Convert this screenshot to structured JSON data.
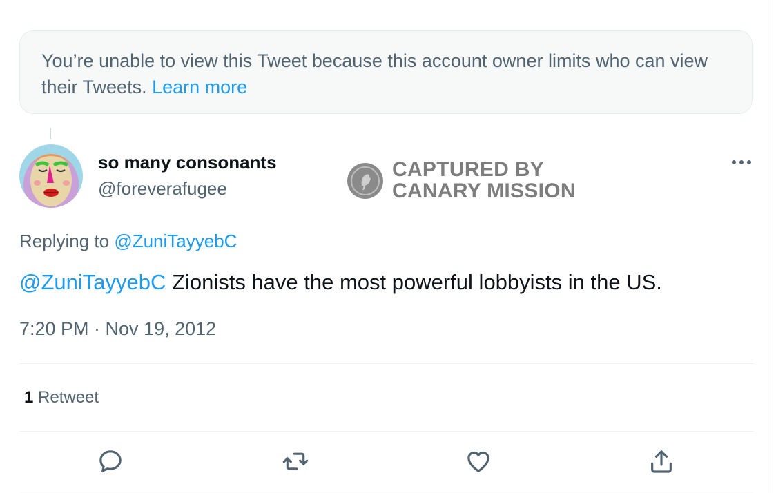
{
  "notice": {
    "text": "You’re unable to view this Tweet because this account owner limits who can view their Tweets.",
    "link": "Learn more"
  },
  "author": {
    "display_name": "so many consonants",
    "handle": "@foreverafugee"
  },
  "watermark": {
    "line1": "CAPTURED BY",
    "line2": "CANARY MISSION"
  },
  "tweet": {
    "replying_label": "Replying to",
    "replying_to": "@ZuniTayyebC",
    "mention": "@ZuniTayyebC",
    "text": "Zionists have the most powerful lobbyists in the US.",
    "timestamp": "7:20 PM · Nov 19, 2012"
  },
  "stats": {
    "retweet_count": "1",
    "retweet_label": "Retweet"
  },
  "actions": [
    "reply-icon",
    "retweet-icon",
    "like-icon",
    "share-icon"
  ],
  "colors": {
    "accent": "#1d9bf0",
    "secondary_text": "#536471",
    "primary_text": "#0f1419",
    "notice_bg": "#f7f9f9"
  }
}
